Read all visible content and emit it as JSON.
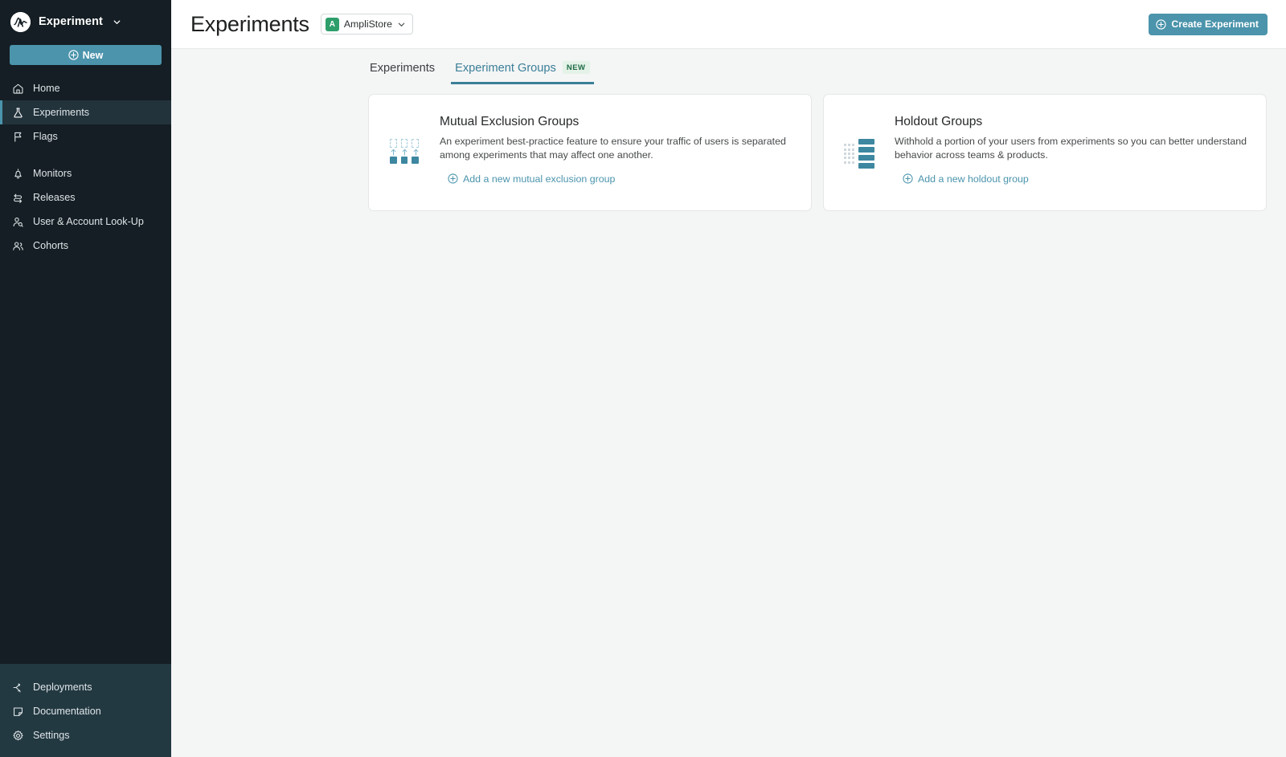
{
  "sidebar": {
    "brand": {
      "name": "Experiment",
      "logo_letter": "A",
      "caret_icon": "chevron-down-icon"
    },
    "new_button": {
      "label": "New",
      "icon": "plus-circle-icon"
    },
    "nav_primary": [
      {
        "label": "Home",
        "icon": "home-icon",
        "active": false
      },
      {
        "label": "Experiments",
        "icon": "flask-icon",
        "active": true
      },
      {
        "label": "Flags",
        "icon": "flag-icon",
        "active": false
      }
    ],
    "nav_secondary": [
      {
        "label": "Monitors",
        "icon": "bell-icon"
      },
      {
        "label": "Releases",
        "icon": "releases-arrows-icon"
      },
      {
        "label": "User & Account Look-Up",
        "icon": "user-search-icon"
      },
      {
        "label": "Cohorts",
        "icon": "people-icon"
      }
    ],
    "nav_bottom": [
      {
        "label": "Deployments",
        "icon": "deployments-icon"
      },
      {
        "label": "Documentation",
        "icon": "document-icon"
      },
      {
        "label": "Settings",
        "icon": "gear-icon"
      }
    ],
    "colors": {
      "background": "#141e24",
      "bottom_background": "#233942",
      "active_accent": "#4b94ac"
    }
  },
  "header": {
    "title": "Experiments",
    "project": {
      "badge_letter": "A",
      "name": "AmpliStore",
      "caret_icon": "chevron-down-icon",
      "badge_color": "#2e9e6b"
    },
    "create_button": {
      "label": "Create Experiment",
      "icon": "plus-circle-icon",
      "color": "#4b94ac"
    }
  },
  "tabs": [
    {
      "label": "Experiments",
      "active": false,
      "badge": ""
    },
    {
      "label": "Experiment Groups",
      "active": true,
      "badge": "NEW"
    }
  ],
  "cards": [
    {
      "icon": "mutual-exclusion-groups-icon",
      "title": "Mutual Exclusion Groups",
      "description": "An experiment best-practice feature to ensure your traffic of users is separated among experiments that may affect one another.",
      "link_label": "Add a new mutual exclusion group",
      "link_icon": "plus-circle-icon"
    },
    {
      "icon": "holdout-groups-icon",
      "title": "Holdout Groups",
      "description": "Withhold a portion of your users from experiments so you can better understand behavior across teams & products.",
      "link_label": "Add a new holdout group",
      "link_icon": "plus-circle-icon"
    }
  ]
}
